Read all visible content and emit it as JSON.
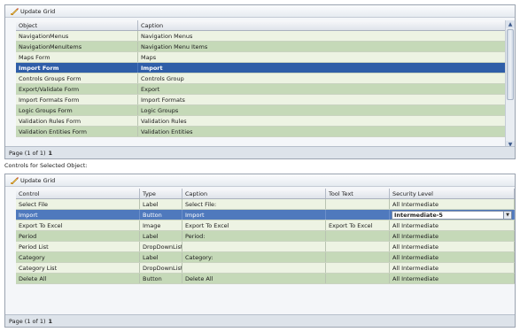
{
  "top_panel": {
    "toolbar": {
      "update_label": "Update Grid"
    },
    "columns": [
      "Object",
      "Caption"
    ],
    "rows": [
      {
        "object": "NavigationMenus",
        "caption": "Navigation Menus",
        "style": "r-light"
      },
      {
        "object": "NavigationMenuItems",
        "caption": "Navigation Menu Items",
        "style": "r-green"
      },
      {
        "object": "Maps Form",
        "caption": "Maps",
        "style": "r-light"
      },
      {
        "object": "Import Form",
        "caption": "Import",
        "style": "r-sel"
      },
      {
        "object": "Controls Groups Form",
        "caption": "Controls Group",
        "style": "r-light"
      },
      {
        "object": "Export/Validate Form",
        "caption": "Export",
        "style": "r-green"
      },
      {
        "object": "Import Formats Form",
        "caption": "Import Formats",
        "style": "r-light"
      },
      {
        "object": "Logic Groups Form",
        "caption": "Logic Groups",
        "style": "r-green"
      },
      {
        "object": "Validation Rules Form",
        "caption": "Validation Rules",
        "style": "r-light"
      },
      {
        "object": "Validation Entities Form",
        "caption": "Validation Entities",
        "style": "r-green"
      }
    ],
    "pager": {
      "text": "Page (1 of 1)",
      "page": "1"
    }
  },
  "section_label": "Controls for Selected Object:",
  "bottom_panel": {
    "toolbar": {
      "update_label": "Update Grid"
    },
    "columns": [
      "Control",
      "Type",
      "Caption",
      "Tool Text",
      "Security Level"
    ],
    "rows": [
      {
        "control": "Select File",
        "type": "Label",
        "caption": "Select File:",
        "tooltext": "",
        "security": "All Intermediate",
        "style": "r-light"
      },
      {
        "control": "Import",
        "type": "Button",
        "caption": "Import",
        "tooltext": "",
        "security": "Intermediate-5",
        "style": "r-bluesel",
        "editing": true
      },
      {
        "control": "Export To Excel",
        "type": "Image",
        "caption": "Export To Excel",
        "tooltext": "Export To Excel",
        "security": "All Intermediate",
        "style": "r-light"
      },
      {
        "control": "Period",
        "type": "Label",
        "caption": "Period:",
        "tooltext": "",
        "security": "All Intermediate",
        "style": "r-green"
      },
      {
        "control": "Period List",
        "type": "DropDownList",
        "caption": "",
        "tooltext": "",
        "security": "All Intermediate",
        "style": "r-light"
      },
      {
        "control": "Category",
        "type": "Label",
        "caption": "Category:",
        "tooltext": "",
        "security": "All Intermediate",
        "style": "r-green"
      },
      {
        "control": "Category List",
        "type": "DropDownList",
        "caption": "",
        "tooltext": "",
        "security": "All Intermediate",
        "style": "r-light"
      },
      {
        "control": "Delete All",
        "type": "Button",
        "caption": "Delete All",
        "tooltext": "",
        "security": "All Intermediate",
        "style": "r-green"
      }
    ],
    "pager": {
      "text": "Page (1 of 1)",
      "page": "1"
    }
  },
  "icons": {
    "update": "pencil-icon",
    "dropdown": "chevron-down-icon",
    "scroll_up": "arrow-up-icon",
    "scroll_down": "arrow-down-icon"
  },
  "colors": {
    "selected_row": "#2f5ea8",
    "green_row": "#c5d9b8",
    "light_row": "#edf3e3"
  }
}
